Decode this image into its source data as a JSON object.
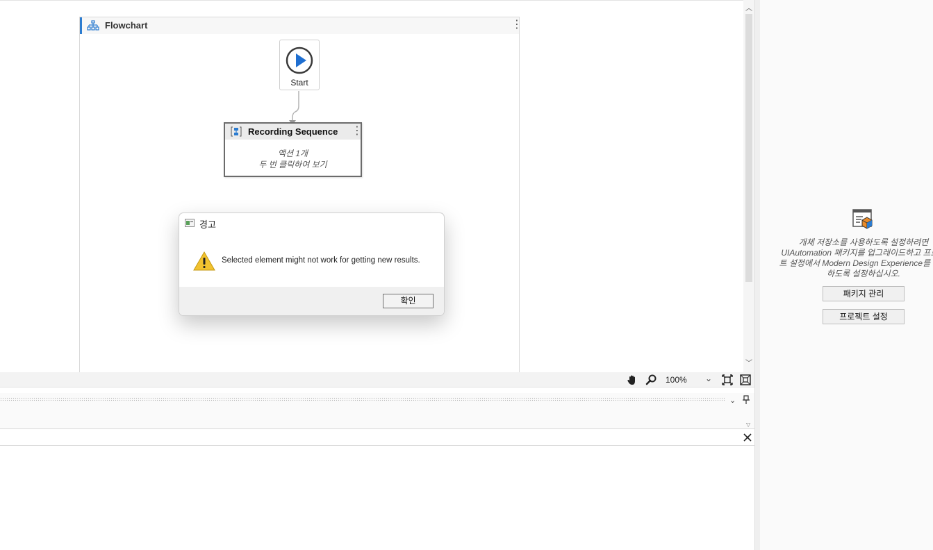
{
  "flowchart": {
    "title": "Flowchart",
    "start_label": "Start",
    "sequence": {
      "title": "Recording Sequence",
      "line1": "액션 1개",
      "line2": "두 번 클릭하여 보기"
    }
  },
  "dialog": {
    "title": "경고",
    "message": "Selected element might not work for getting new results.",
    "ok_label": "확인"
  },
  "toolbar": {
    "zoom": "100%"
  },
  "right_panel": {
    "lines": [
      "개체 저장소를 사용하도록 설정하려면",
      "UIAutomation 패키지를 업그레이드하고 프로젝",
      "트 설정에서 Modern Design Experience를 사용",
      "하도록 설정하십시오."
    ],
    "manage_packages_label": "패키지 관리",
    "project_settings_label": "프로젝트 설정"
  },
  "colors": {
    "accent": "#2c7cd0",
    "warning": "#f2c230"
  }
}
